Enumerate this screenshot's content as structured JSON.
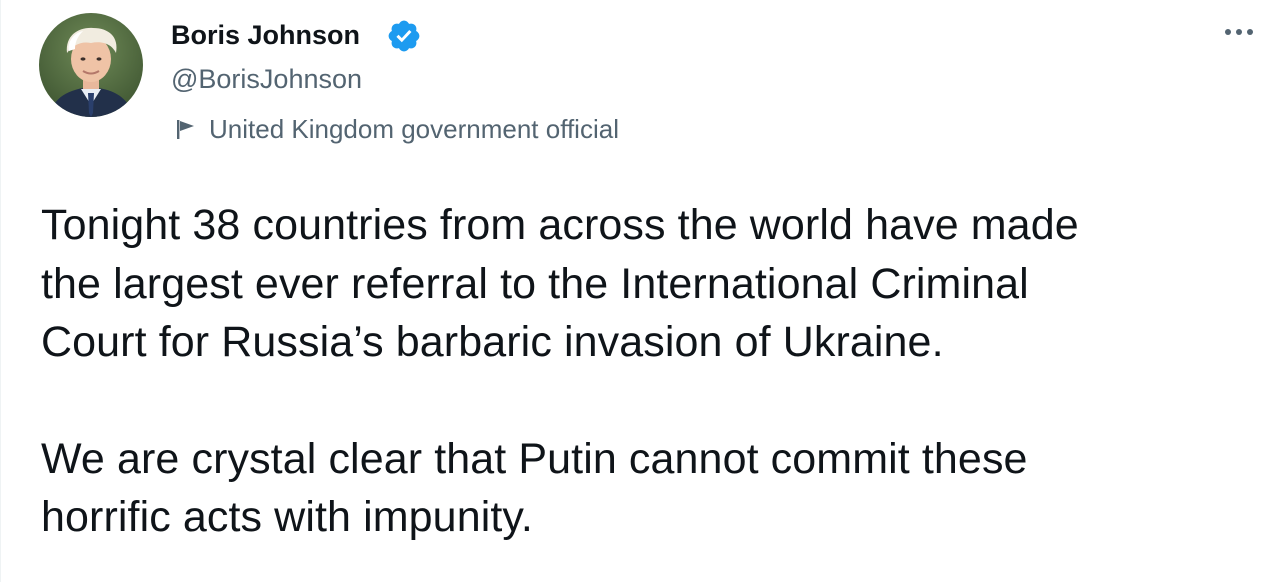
{
  "author": {
    "display_name": "Boris Johnson",
    "handle": "@BorisJohnson",
    "verified": true,
    "verified_color": "#1d9bf0",
    "label": "United Kingdom government official",
    "label_icon": "flag-icon"
  },
  "menu": {
    "icon": "more-horizontal-icon"
  },
  "tweet": {
    "paragraphs": [
      "Tonight 38 countries from across the world have made\nthe largest ever referral to the International Criminal\nCourt for Russia’s barbaric invasion of Ukraine.",
      "We are crystal clear that Putin cannot commit these\nhorrific acts with impunity."
    ]
  }
}
